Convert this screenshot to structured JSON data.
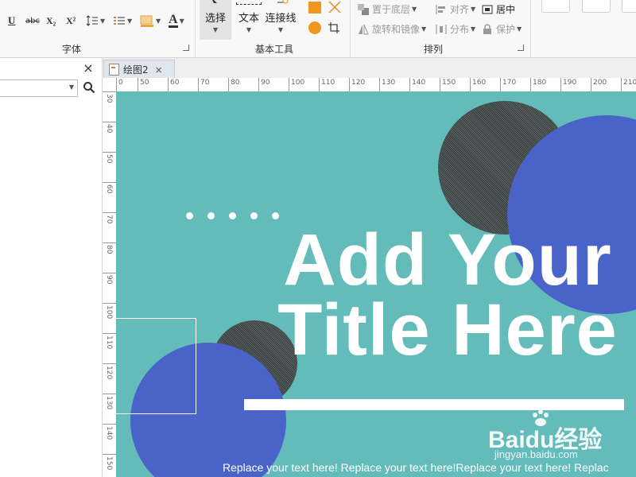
{
  "ribbon": {
    "font_group_label": "字体",
    "format_buttons": [
      {
        "name": "underline",
        "label": "U"
      },
      {
        "name": "strikethrough",
        "label": "abc"
      },
      {
        "name": "subscript",
        "label": "X₂"
      },
      {
        "name": "superscript",
        "label": "X²"
      }
    ],
    "tools_group_label": "基本工具",
    "tools": {
      "select": "选择",
      "text": "文本",
      "connector": "连接线"
    },
    "arrange_group_label": "排列",
    "arrange": {
      "send_back": "置于底层",
      "rotate_flip": "旋转和镜像",
      "align": "对齐",
      "distribute": "分布",
      "center": "居中",
      "protect": "保护"
    }
  },
  "document_tab": {
    "title": "绘图2",
    "close": "×"
  },
  "left_panel": {
    "close": "×"
  },
  "ruler": {
    "horizontal": [
      "0",
      "50",
      "60",
      "70",
      "80",
      "90",
      "100",
      "110",
      "120",
      "130",
      "140",
      "150",
      "160",
      "170",
      "180",
      "190",
      "200",
      "210"
    ],
    "vertical": [
      "30",
      "40",
      "50",
      "60",
      "70",
      "80",
      "90",
      "100",
      "110",
      "120",
      "130",
      "140",
      "150"
    ]
  },
  "canvas": {
    "title_line1": "Add Your",
    "title_line2": "Title Here",
    "footer": "Replace your text here!   Replace your text here!Replace your text here!   Replac",
    "colors": {
      "background": "#63bcba",
      "accent_blue": "#4a63c8",
      "dark": "#3d4545",
      "white": "#ffffff"
    }
  },
  "watermark": {
    "main": "Baidu经验",
    "sub": "jingyan.baidu.com"
  }
}
